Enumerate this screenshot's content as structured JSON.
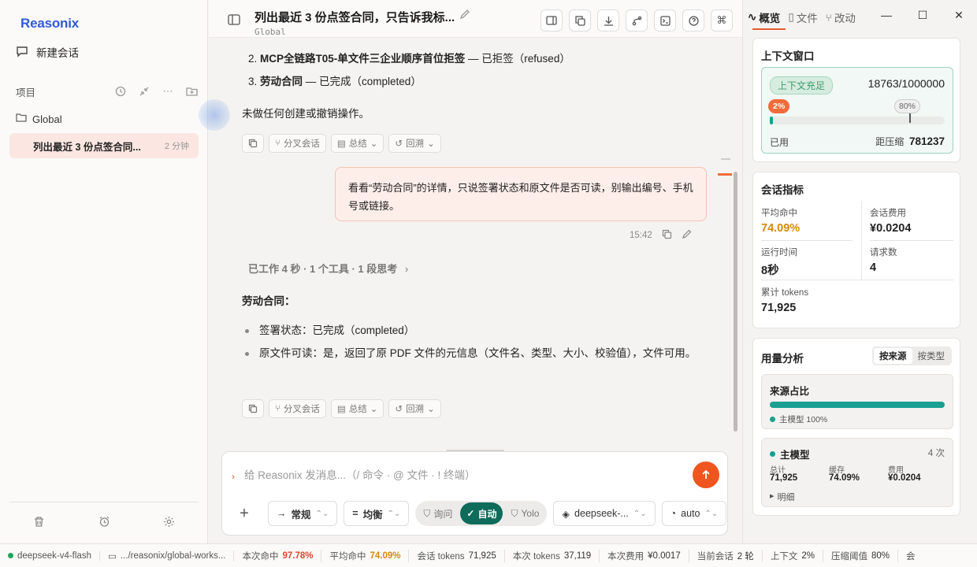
{
  "sidebar": {
    "brand": "Reasonix",
    "new_chat": "新建会话",
    "projects_label": "项目",
    "folder": "Global",
    "chat_item": {
      "title": "列出最近 3 份点签合同...",
      "ago": "2 分钟"
    }
  },
  "header": {
    "title": "列出最近 3 份点签合同，只告诉我标...",
    "subtitle": "Global"
  },
  "chat": {
    "list_items": [
      {
        "num": "2.",
        "bold": "MCP全链路T05-单文件三企业顺序首位拒签",
        "rest": " — 已拒签（refused）"
      },
      {
        "num": "3.",
        "bold": "劳动合同",
        "rest": " — 已完成（completed）"
      }
    ],
    "no_action": "未做任何创建或撤销操作。",
    "actions": {
      "fork": "分叉会话",
      "summary": "总结",
      "rewind": "回溯"
    },
    "user_msg": "看看“劳动合同”的详情，只说签署状态和原文件是否可读，别输出编号、手机号或链接。",
    "user_time": "15:42",
    "worked": "已工作 4 秒 · 1 个工具 · 1 段思考",
    "answer_title": "劳动合同：",
    "bullets": [
      "签署状态：已完成（completed）",
      "原文件可读：是，返回了原 PDF 文件的元信息（文件名、类型、大小、校验值），文件可用。"
    ]
  },
  "composer": {
    "placeholder": "给 Reasonix 发消息...（/ 命令 · @ 文件 · ! 终端）",
    "style_sel": "常规",
    "balance_sel": "均衡",
    "modes": [
      "询问",
      "自动",
      "Yolo"
    ],
    "model_sel": "deepseek-...",
    "effort_sel": "auto"
  },
  "panel": {
    "tabs": [
      "概览",
      "文件",
      "改动"
    ],
    "context": {
      "title": "上下文窗口",
      "status": "上下文充足",
      "count": "18763/1000000",
      "pct_label": "2%",
      "pct_value": 0.0188,
      "threshold_label": "80%",
      "threshold_value": 0.8,
      "used_label": "已用",
      "left_label": "距压缩",
      "left_value": "781237"
    },
    "metrics": {
      "title": "会话指标",
      "hit_label": "平均命中",
      "hit_value": "74.09%",
      "cost_label": "会话费用",
      "cost_value": "¥0.0204",
      "runtime_label": "运行时间",
      "runtime_value": "8秒",
      "req_label": "请求数",
      "req_value": "4",
      "tokens_label": "累计 tokens",
      "tokens_value": "71,925"
    },
    "usage": {
      "title": "用量分析",
      "seg": [
        "按来源",
        "按类型"
      ],
      "source_title": "来源占比",
      "source_bar": 1.0,
      "source_legend": "主模型 100%",
      "model_title": "主模型",
      "model_count": "4 次",
      "cols": [
        {
          "k": "总计",
          "v": "71,925"
        },
        {
          "k": "缓存",
          "v": "74.09%"
        },
        {
          "k": "费用",
          "v": "¥0.0204"
        }
      ],
      "detail": "明细"
    }
  },
  "status": {
    "model": "deepseek-v4-flash",
    "path": ".../reasonix/global-works...",
    "hit_label": "本次命中",
    "hit_value": "97.78%",
    "avg_label": "平均命中",
    "avg_value": "74.09%",
    "session_tokens": "会话 tokens",
    "session_tokens_value": "71,925",
    "turn_tokens": "本次 tokens",
    "turn_tokens_value": "37,119",
    "turn_cost": "本次费用",
    "turn_cost_value": "¥0.0017",
    "current": "当前会话",
    "current_value": "2 轮",
    "ctx": "上下文",
    "ctx_value": "2%",
    "threshold": "压缩阈值",
    "threshold_value": "80%",
    "tail": "会"
  },
  "colors": {
    "accent": "#f0551f",
    "brand": "#2f5ad8",
    "teal": "#19a090",
    "auto_mode": "#0f6b5a"
  }
}
